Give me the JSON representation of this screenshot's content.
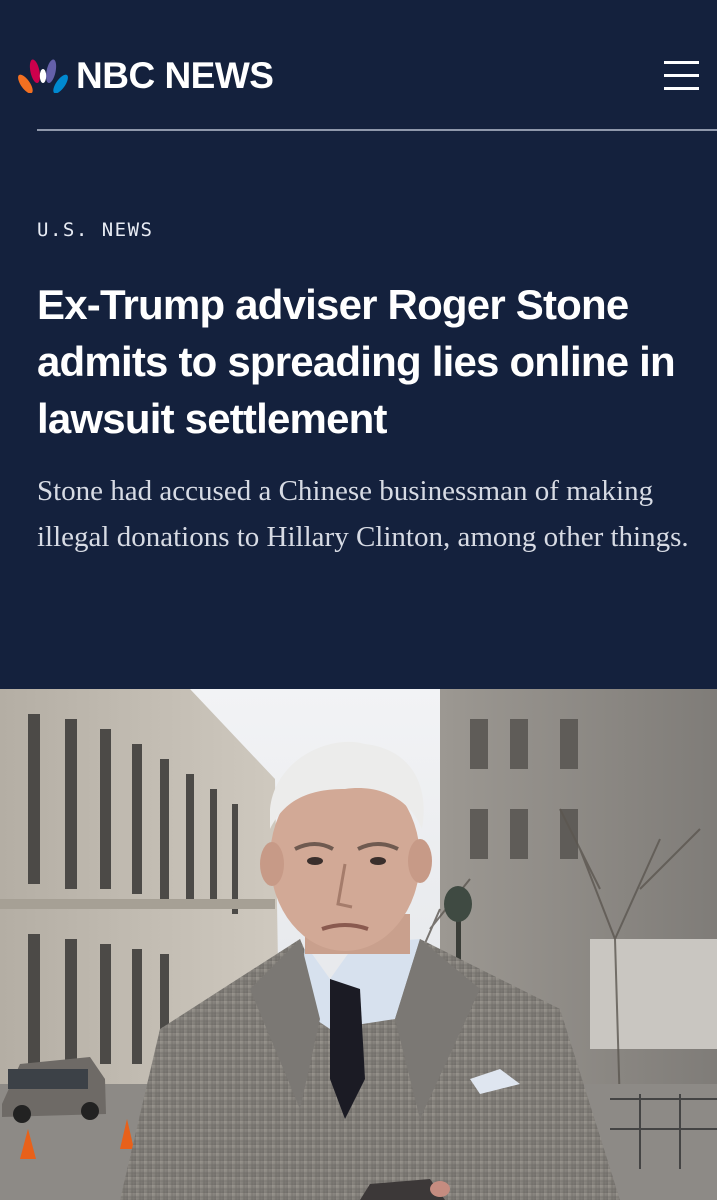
{
  "header": {
    "brand": "NBC NEWS",
    "logo_icon": "peacock-icon",
    "menu_icon": "hamburger-menu-icon"
  },
  "article": {
    "section": "U.S. NEWS",
    "headline": "Ex-Trump adviser Roger Stone admits to spreading lies online in lawsuit settlement",
    "dek": "Stone had accused a Chinese businessman of making illegal donations to Hillary Clinton, among other things."
  },
  "colors": {
    "background": "#14213d",
    "text": "#ffffff",
    "divider": "#8f98ab"
  }
}
